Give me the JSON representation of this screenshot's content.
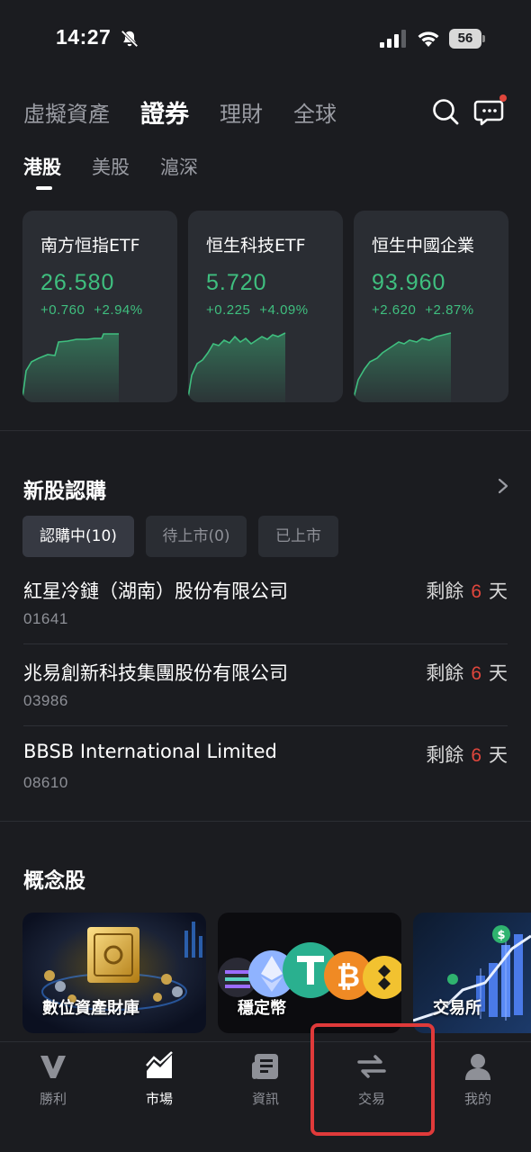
{
  "status_bar": {
    "time": "14:27",
    "battery": "56"
  },
  "top_tabs": [
    "虛擬資產",
    "證券",
    "理財",
    "全球"
  ],
  "top_tab_active": 1,
  "sub_tabs": [
    "港股",
    "美股",
    "滬深"
  ],
  "sub_tab_active": 0,
  "index_cards": [
    {
      "name": "南方恒指ETF",
      "price": "26.580",
      "change": "+0.760",
      "change_pct": "+2.94%"
    },
    {
      "name": "恒生科技ETF",
      "price": "5.720",
      "change": "+0.225",
      "change_pct": "+4.09%"
    },
    {
      "name": "恒生中國企業",
      "price": "93.960",
      "change": "+2.620",
      "change_pct": "+2.87%"
    }
  ],
  "ipo": {
    "title": "新股認購",
    "filters": [
      "認購中(10)",
      "待上市(0)",
      "已上市"
    ],
    "active_filter": 0,
    "remaining_prefix": "剩餘",
    "remaining_suffix": "天",
    "items": [
      {
        "name": "紅星冷鏈（湖南）股份有限公司",
        "code": "01641",
        "days": "6"
      },
      {
        "name": "兆易創新科技集團股份有限公司",
        "code": "03986",
        "days": "6"
      },
      {
        "name": "BBSB International Limited",
        "code": "08610",
        "days": "6"
      }
    ]
  },
  "concept": {
    "title": "概念股",
    "items": [
      {
        "label": "數位資產財庫"
      },
      {
        "label": "穩定幣"
      },
      {
        "label": "交易所"
      }
    ]
  },
  "bottom_nav": {
    "items": [
      {
        "label": "勝利",
        "icon": "v-logo-icon"
      },
      {
        "label": "市場",
        "icon": "market-chart-icon"
      },
      {
        "label": "資訊",
        "icon": "news-icon"
      },
      {
        "label": "交易",
        "icon": "exchange-arrows-icon"
      },
      {
        "label": "我的",
        "icon": "profile-icon"
      }
    ],
    "active": 1
  },
  "colors": {
    "background": "#1b1c20",
    "card": "#2a2d33",
    "up_green": "#3fbf7f",
    "days_red": "#e0463c",
    "highlight": "#e03a3a"
  }
}
